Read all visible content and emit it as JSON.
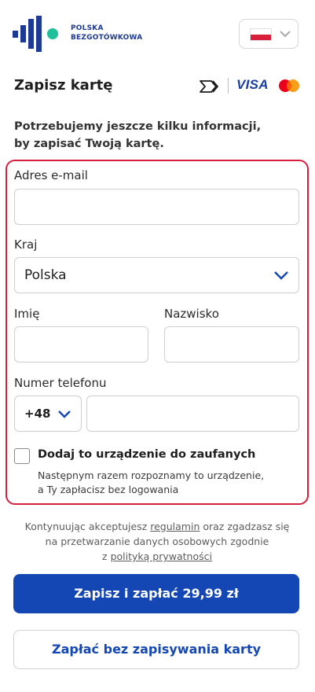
{
  "header": {
    "logo_line1": "POLSKA",
    "logo_line2": "BEZGOTÓWKOWA",
    "language": {
      "flag": "flag-pl-icon",
      "flag_colors": [
        "#ffffff",
        "#d8213a"
      ]
    }
  },
  "page": {
    "title": "Zapisz kartę",
    "brands": [
      "card-scan-icon",
      "VISA",
      "mastercard-icon"
    ],
    "info_line1": "Potrzebujemy jeszcze kilku informacji,",
    "info_line2": "by zapisać Twoją kartę."
  },
  "form": {
    "email_label": "Adres e-mail",
    "email_value": "",
    "country_label": "Kraj",
    "country_value": "Polska",
    "first_name_label": "Imię",
    "first_name_value": "",
    "last_name_label": "Nazwisko",
    "last_name_value": "",
    "phone_label": "Numer telefonu",
    "phone_prefix": "+48",
    "phone_value": "",
    "trusted_device_label": "Dodaj to urządzenie do zaufanych",
    "trusted_device_hint_line1": "Następnym razem rozpoznamy to urządzenie,",
    "trusted_device_hint_line2": "a Ty zapłacisz bez logowania",
    "trusted_device_checked": false
  },
  "consent": {
    "part1": "Kontynuując akceptujesz ",
    "link_terms": "regulamin",
    "part2": " oraz zgadzasz się",
    "part3": "na przetwarzanie danych osobowych zgodnie",
    "part4": "z ",
    "link_privacy": "polityką prywatności"
  },
  "actions": {
    "primary": "Zapisz i zapłać 29,99 zł",
    "secondary": "Zapłać bez zapisywania karty"
  },
  "colors": {
    "accent": "#1447b3",
    "error_border": "#d61f3e",
    "logo_teal": "#1fbf9c"
  }
}
